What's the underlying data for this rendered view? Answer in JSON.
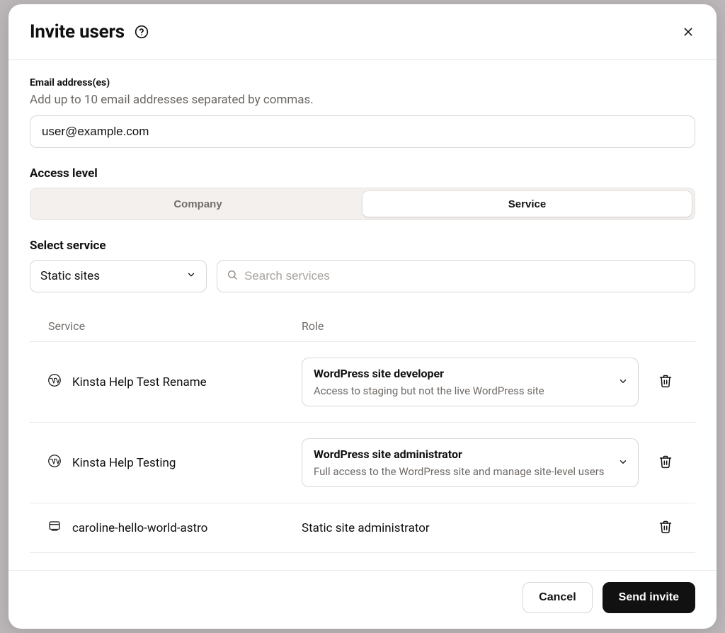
{
  "modal": {
    "title": "Invite users"
  },
  "email": {
    "label": "Email address(es)",
    "hint": "Add up to 10 email addresses separated by commas.",
    "value": "user@example.com"
  },
  "access": {
    "label": "Access level",
    "tabs": {
      "company": "Company",
      "service": "Service"
    },
    "active": "service"
  },
  "service": {
    "label": "Select service",
    "selected": "Static sites",
    "search_placeholder": "Search services"
  },
  "table": {
    "headers": {
      "service": "Service",
      "role": "Role"
    },
    "rows": [
      {
        "icon": "wordpress",
        "name": "Kinsta Help Test Rename",
        "role": {
          "title": "WordPress site developer",
          "description": "Access to staging but not the live WordPress site"
        },
        "role_type": "dropdown"
      },
      {
        "icon": "wordpress",
        "name": "Kinsta Help Testing",
        "role": {
          "title": "WordPress site administrator",
          "description": "Full access to the WordPress site and manage site-level users"
        },
        "role_type": "dropdown"
      },
      {
        "icon": "static",
        "name": "caroline-hello-world-astro",
        "role": {
          "title": "Static site administrator"
        },
        "role_type": "static"
      }
    ]
  },
  "footer": {
    "cancel": "Cancel",
    "send": "Send invite"
  }
}
